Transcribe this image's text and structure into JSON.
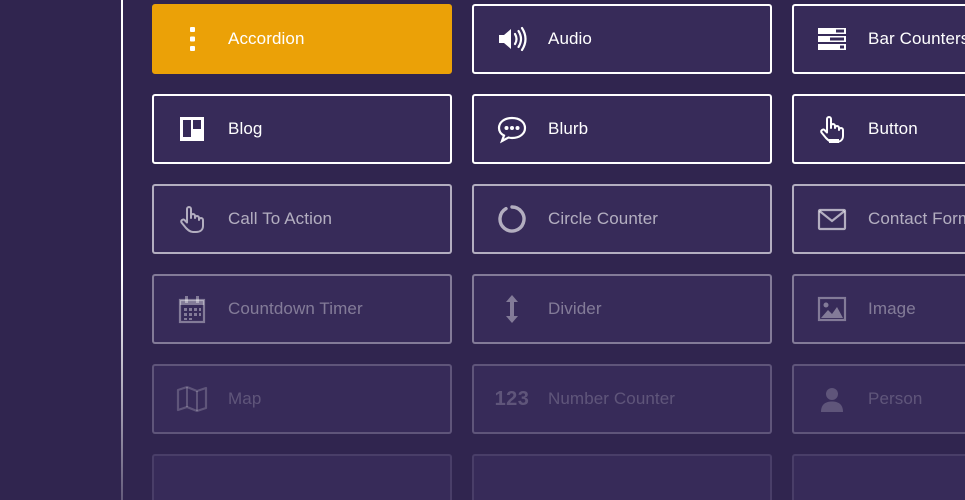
{
  "modules": [
    {
      "label": "Accordion",
      "icon": "vertical-dots-icon",
      "active": true
    },
    {
      "label": "Audio",
      "icon": "speaker-icon"
    },
    {
      "label": "Bar Counters",
      "icon": "bar-counters-icon"
    },
    {
      "label": "Blog",
      "icon": "blog-layout-icon"
    },
    {
      "label": "Blurb",
      "icon": "speech-bubble-icon"
    },
    {
      "label": "Button",
      "icon": "pointing-hand-icon"
    },
    {
      "label": "Call To Action",
      "icon": "pointing-hand-icon"
    },
    {
      "label": "Circle Counter",
      "icon": "circle-counter-icon"
    },
    {
      "label": "Contact Form",
      "icon": "envelope-icon"
    },
    {
      "label": "Countdown Timer",
      "icon": "calendar-icon"
    },
    {
      "label": "Divider",
      "icon": "vertical-arrow-icon"
    },
    {
      "label": "Image",
      "icon": "image-icon"
    },
    {
      "label": "Map",
      "icon": "map-icon"
    },
    {
      "label": "Number Counter",
      "icon": "number-counter-icon",
      "icon_text": "123"
    },
    {
      "label": "Person",
      "icon": "person-icon"
    }
  ],
  "colors": {
    "background": "#30254f",
    "tile": "#372b59",
    "active": "#eba107",
    "border": "#ffffff"
  }
}
